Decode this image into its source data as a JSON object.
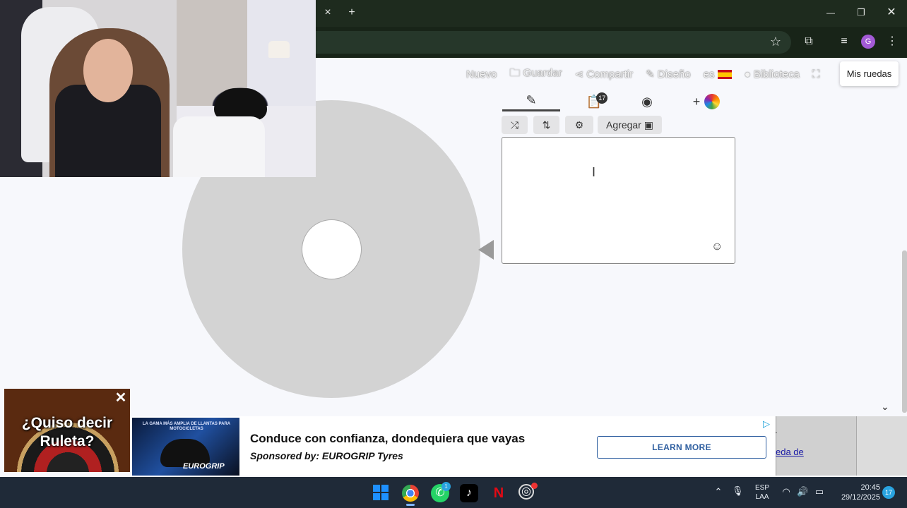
{
  "browser": {
    "tab_close": "×",
    "new_tab": "+",
    "minimize": "—",
    "maximize": "❐",
    "close": "✕",
    "star": "☆",
    "extensions": "⧉",
    "media": "≡",
    "profile_initial": "G",
    "menu": "⋮"
  },
  "site_nav": {
    "nuevo": "Nuevo",
    "guardar": "Guardar",
    "compartir": "Compartir",
    "diseno": "Diseño",
    "language": "es",
    "biblioteca": "Biblioteca",
    "mis_ruedas": "Mis ruedas"
  },
  "editor": {
    "tabs": [
      {
        "icon": "pencil-icon",
        "glyph": "✎",
        "active": true
      },
      {
        "icon": "clipboard-icon",
        "glyph": "📋",
        "badge": "17"
      },
      {
        "icon": "eye-off-icon",
        "glyph": "◉"
      },
      {
        "icon": "add-color-icon",
        "glyph": "+"
      }
    ],
    "toolbar": {
      "shuffle": "⤮",
      "sort": "⇅",
      "settings": "⚙",
      "add_label": "Agregar",
      "add_image_glyph": "▣"
    },
    "text_cursor": "I",
    "emoji": "☺"
  },
  "roulette_ad": {
    "text": "¿Quiso decir Ruleta?",
    "close": "✕"
  },
  "banner_ad": {
    "headline": "Conduce con confianza, dondequiera que vayas",
    "sponsor": "Sponsored by: EUROGRIP Tyres",
    "cta": "LEARN MORE",
    "brand": "EUROGRIP",
    "image_text": "LA GAMA MÁS AMPLIA DE LLANTAS PARA MOTOCICLETAS",
    "adchoice": "▷"
  },
  "side_text": {
    "dot": ".",
    "link": "eda de"
  },
  "chevron": "⌄",
  "taskbar": {
    "whatsapp_badge": "1",
    "lang_top": "ESP",
    "lang_bottom": "LAA",
    "time": "20:45",
    "date": "29/12/2025",
    "notifications": "17"
  },
  "colors": {
    "wheel": "#d3d3d3",
    "tab_bar": "#1e2b1e",
    "taskbar": "#1f2a38",
    "cta_blue": "#2f5fa0"
  }
}
